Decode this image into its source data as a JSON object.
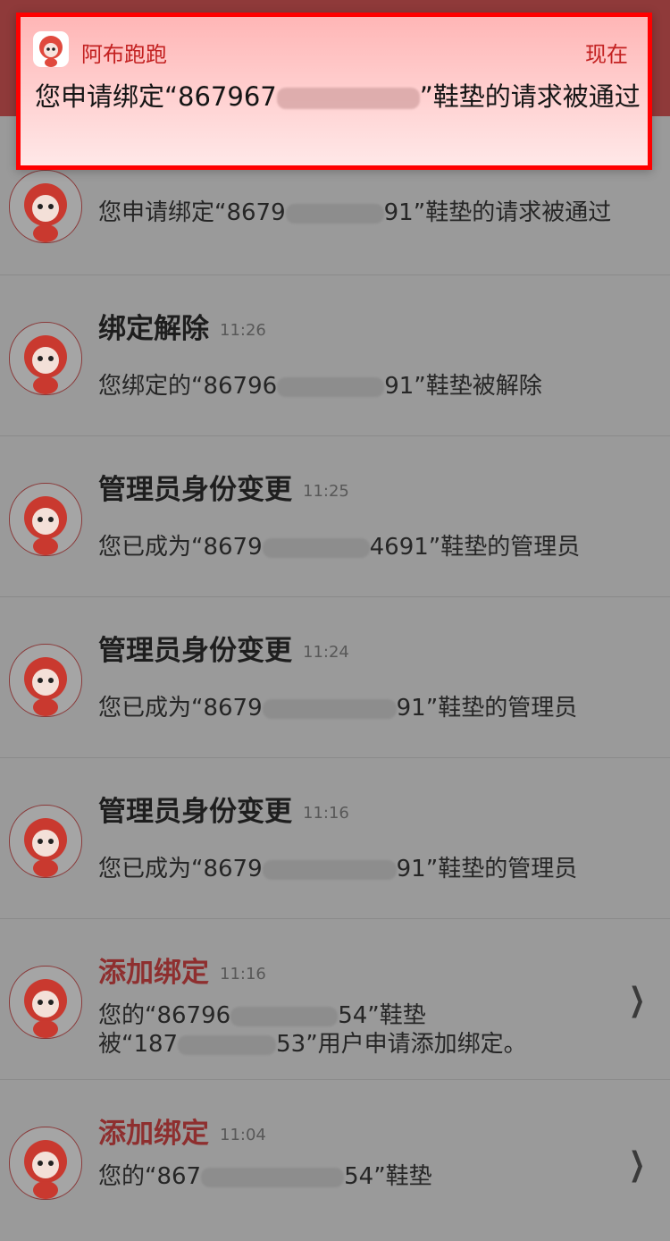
{
  "notification": {
    "app_name": "阿布跑跑",
    "time": "现在",
    "message_prefix": "您申请绑定“867967",
    "message_suffix": "”鞋垫的请求被通过"
  },
  "messages": [
    {
      "title": "",
      "time": "",
      "body_prefix": "您申请绑定“8679",
      "body_suffix": "91”鞋垫的请求被通过",
      "chevron": false
    },
    {
      "title": "绑定解除",
      "time": "11:26",
      "body_prefix": "您绑定的“86796",
      "body_suffix": "91”鞋垫被解除",
      "chevron": false
    },
    {
      "title": "管理员身份变更",
      "time": "11:25",
      "body_prefix": "您已成为“8679",
      "body_suffix": "4691”鞋垫的管理员",
      "chevron": false
    },
    {
      "title": "管理员身份变更",
      "time": "11:24",
      "body_prefix": "您已成为“8679",
      "body_suffix": "91”鞋垫的管理员",
      "chevron": false
    },
    {
      "title": "管理员身份变更",
      "time": "11:16",
      "body_prefix": "您已成为“8679",
      "body_suffix": "91”鞋垫的管理员",
      "chevron": false
    },
    {
      "title": "添加绑定",
      "time": "11:16",
      "body_prefix": "您的“86796",
      "body_suffix": "54”鞋垫",
      "body2_prefix": "被“187",
      "body2_suffix": "53”用户申请添加绑定。",
      "chevron": true
    },
    {
      "title": "添加绑定",
      "time": "11:04",
      "body_prefix": "您的“867",
      "body_suffix": "54”鞋垫",
      "chevron": true
    }
  ],
  "colors": {
    "banner_border": "#ff0000",
    "accent_red": "#c32020",
    "title_red": "#8e2f2f"
  },
  "icons": {
    "app_icon": "red-mascot-icon",
    "avatar": "red-mascot-avatar",
    "chevron": "chevron-right-icon"
  }
}
